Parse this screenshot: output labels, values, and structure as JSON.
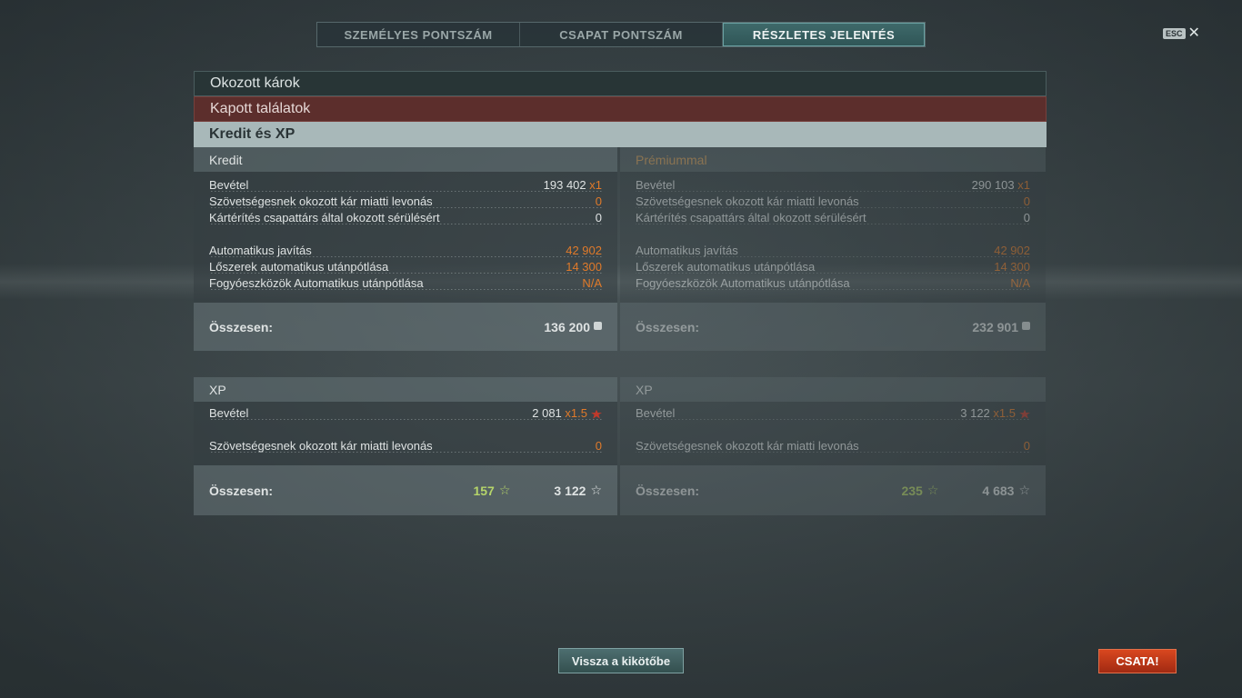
{
  "tabs": [
    {
      "label": "SZEMÉLYES PONTSZÁM",
      "active": false
    },
    {
      "label": "CSAPAT PONTSZÁM",
      "active": false
    },
    {
      "label": "RÉSZLETES JELENTÉS",
      "active": true
    }
  ],
  "esc_label": "ESC",
  "close_icon": "close-icon",
  "sections": {
    "damage_dealt": "Okozott károk",
    "hits_received": "Kapott találatok",
    "credits_xp": "Kredit és XP"
  },
  "credits": {
    "standard": {
      "title": "Kredit",
      "rows": [
        {
          "label": "Bevétel",
          "value": "193 402",
          "suffix": "x1"
        },
        {
          "label": "Szövetségesnek okozott kár miatti levonás",
          "value": "0"
        },
        {
          "label": "Kártérítés csapattárs által okozott sérülésért",
          "value": "0"
        },
        {
          "label": "Automatikus javítás",
          "value": "42 902"
        },
        {
          "label": "Lőszerek automatikus utánpótlása",
          "value": "14 300"
        },
        {
          "label": "Fogyóeszközök Automatikus utánpótlása",
          "value": "N/A"
        }
      ],
      "total_label": "Összesen:",
      "total": "136 200"
    },
    "premium": {
      "title": "Prémiummal",
      "rows": [
        {
          "label": "Bevétel",
          "value": "290 103",
          "suffix": "x1"
        },
        {
          "label": "Szövetségesnek okozott kár miatti levonás",
          "value": "0"
        },
        {
          "label": "Kártérítés csapattárs által okozott sérülésért",
          "value": "0"
        },
        {
          "label": "Automatikus javítás",
          "value": "42 902"
        },
        {
          "label": "Lőszerek automatikus utánpótlása",
          "value": "14 300"
        },
        {
          "label": "Fogyóeszközök Automatikus utánpótlása",
          "value": "N/A"
        }
      ],
      "total_label": "Összesen:",
      "total": "232 901"
    }
  },
  "xp": {
    "standard": {
      "title": "XP",
      "income_label": "Bevétel",
      "income_value": "2 081",
      "income_multiplier": "x1.5",
      "deduction_label": "Szövetségesnek okozott kár miatti levonás",
      "deduction_value": "0",
      "total_label": "Összesen:",
      "free_xp": "157",
      "total": "3 122"
    },
    "premium": {
      "title": "XP",
      "income_label": "Bevétel",
      "income_value": "3 122",
      "income_multiplier": "x1.5",
      "deduction_label": "Szövetségesnek okozott kár miatti levonás",
      "deduction_value": "0",
      "total_label": "Összesen:",
      "free_xp": "235",
      "total": "4 683"
    }
  },
  "buttons": {
    "back": "Vissza a kikötőbe",
    "battle": "CSATA!"
  },
  "colors": {
    "accent_orange": "#e07a2a",
    "free_xp_green": "#b5d46a",
    "battle_red": "#c0391b"
  }
}
